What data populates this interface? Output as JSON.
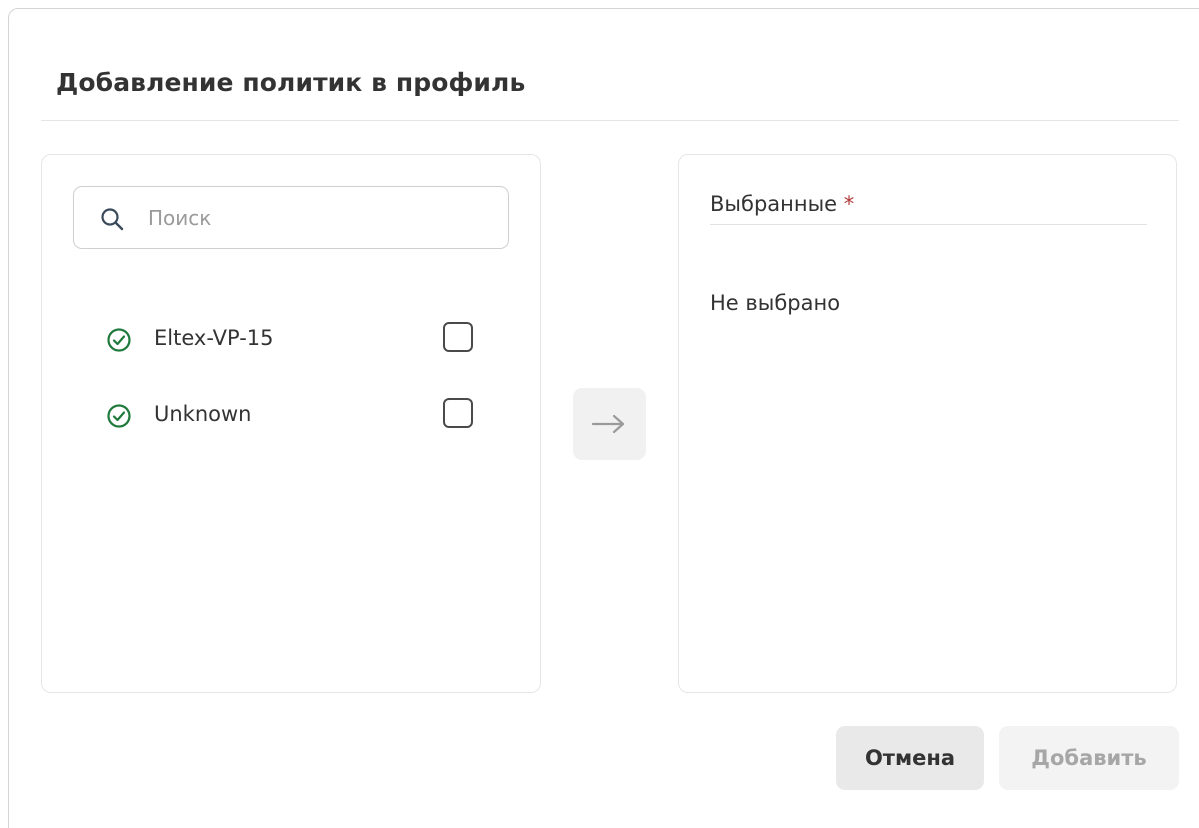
{
  "dialog": {
    "title": "Добавление политик в профиль"
  },
  "search": {
    "placeholder": "Поиск",
    "value": ""
  },
  "available": {
    "items": [
      {
        "label": "Eltex-VP-15",
        "status_icon": "check-circle-icon",
        "checked": false
      },
      {
        "label": "Unknown",
        "status_icon": "check-circle-icon",
        "checked": false
      }
    ]
  },
  "move_button": {
    "icon": "arrow-right-icon"
  },
  "selected": {
    "label": "Выбранные",
    "required_mark": "*",
    "empty_text": "Не выбрано"
  },
  "footer": {
    "cancel_label": "Отмена",
    "add_label": "Добавить"
  },
  "colors": {
    "status_green": "#1f7a3c",
    "required_red": "#b3393b",
    "disabled_text": "#a6a6a6"
  }
}
